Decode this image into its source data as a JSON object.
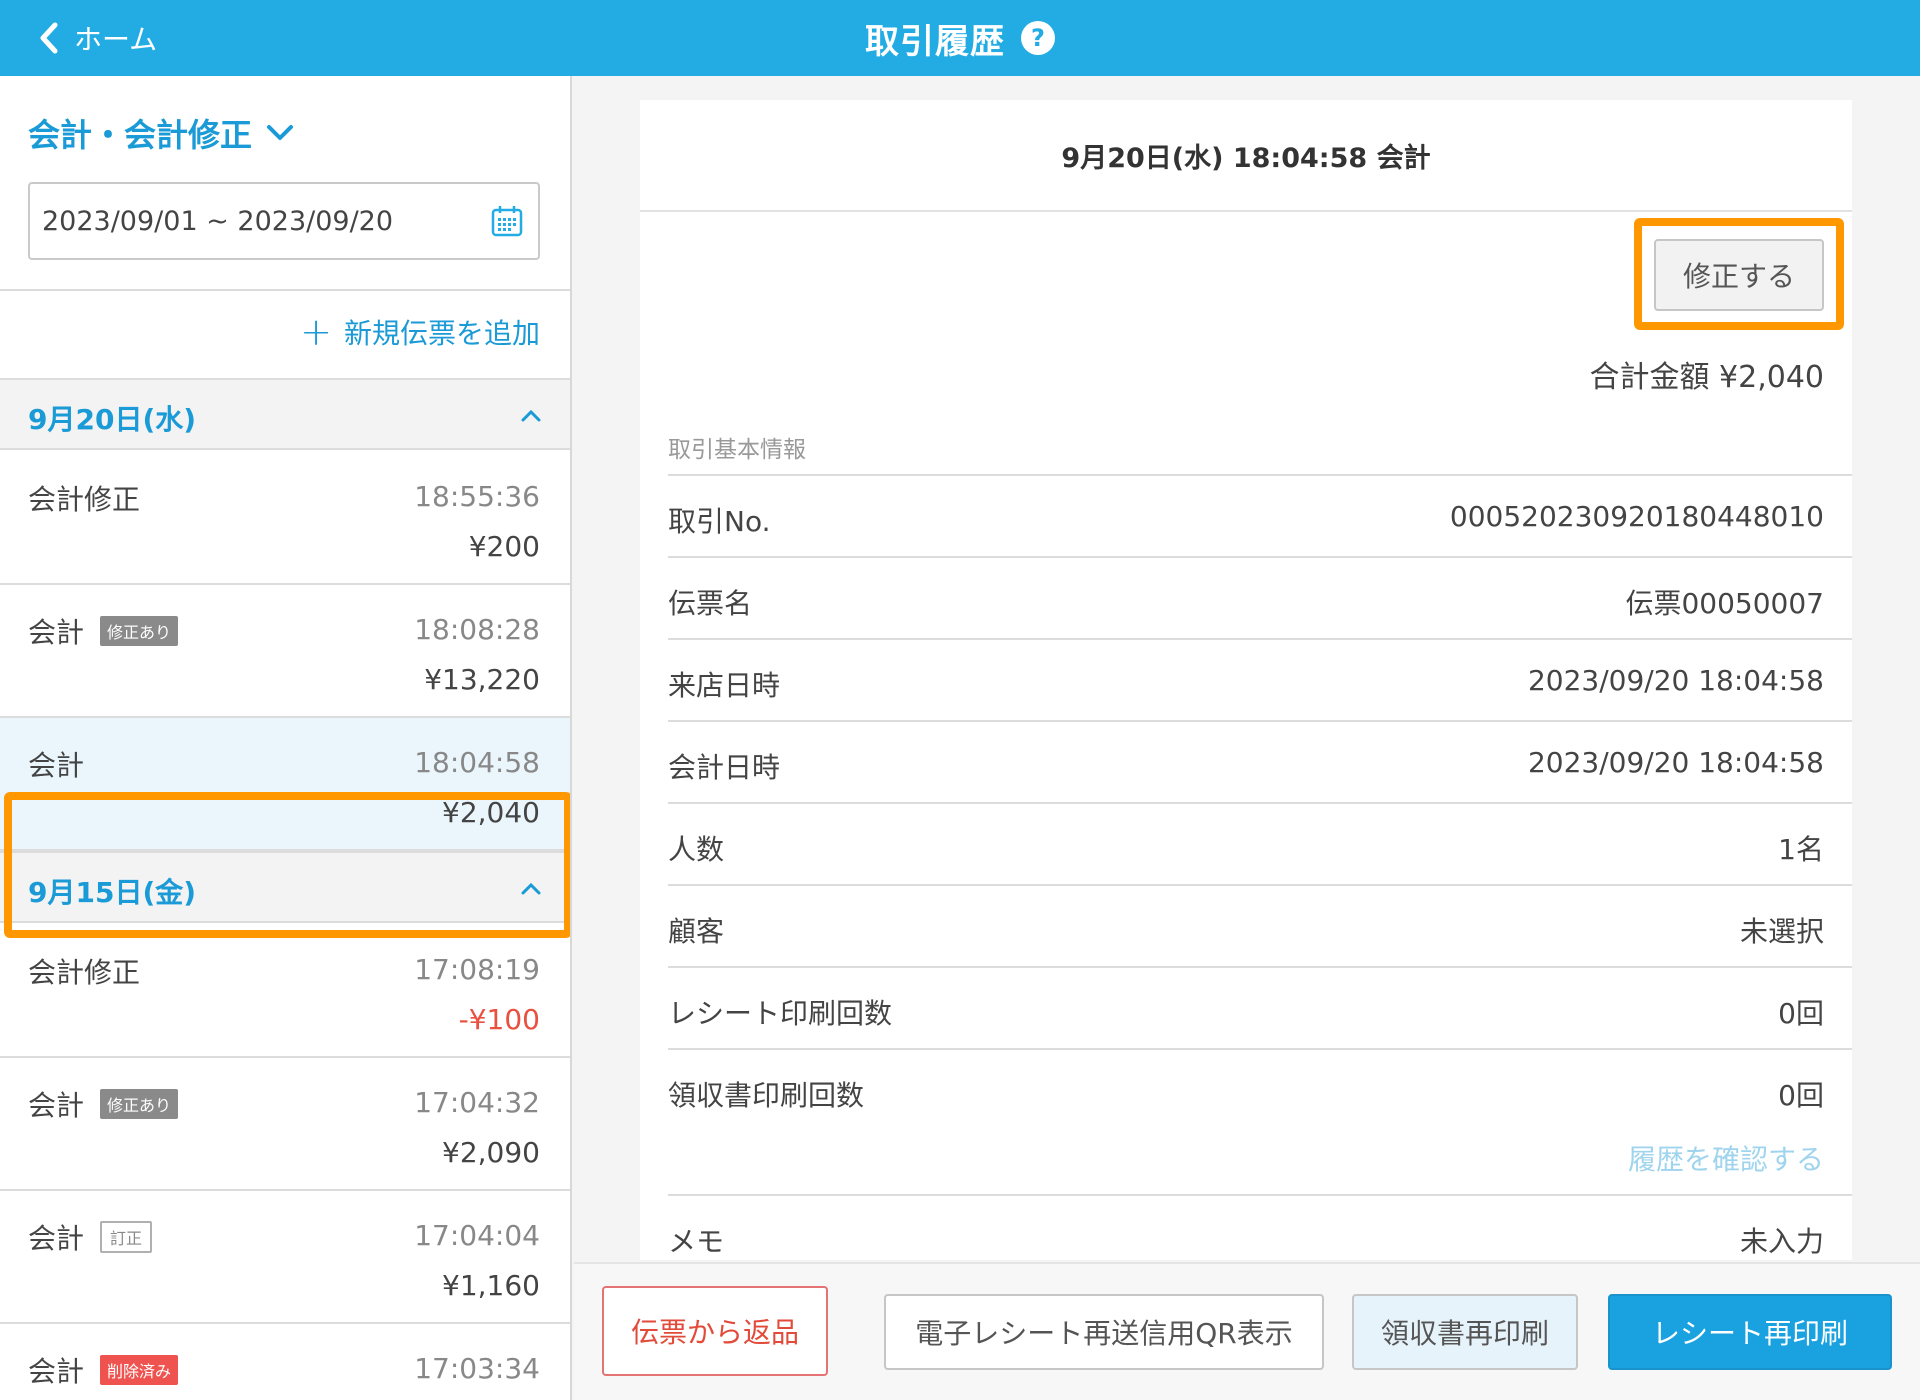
{
  "header": {
    "back_label": "ホーム",
    "title": "取引履歴",
    "help_symbol": "?"
  },
  "sidebar": {
    "filter_label": "会計・会計修正",
    "date_range": "2023/09/01 ~ 2023/09/20",
    "add_slip_label": "新規伝票を追加",
    "groups": [
      {
        "date": "9月20日(水)",
        "items": [
          {
            "kind": "会計修正",
            "time": "18:55:36",
            "amount": "¥200"
          },
          {
            "kind": "会計",
            "badge": "修正あり",
            "time": "18:08:28",
            "amount": "¥13,220"
          },
          {
            "kind": "会計",
            "time": "18:04:58",
            "amount": "¥2,040"
          }
        ]
      },
      {
        "date": "9月15日(金)",
        "items": [
          {
            "kind": "会計修正",
            "time": "17:08:19",
            "amount": "-¥100"
          },
          {
            "kind": "会計",
            "badge": "修正あり",
            "time": "17:04:32",
            "amount": "¥2,090"
          },
          {
            "kind": "会計",
            "badge": "訂正",
            "time": "17:04:04",
            "amount": "¥1,160"
          },
          {
            "kind": "会計",
            "badge": "削除済み",
            "time": "17:03:34",
            "amount": ""
          }
        ]
      }
    ]
  },
  "detail": {
    "title": "9月20日(水) 18:04:58 会計",
    "edit_label": "修正する",
    "total": "合計金額 ¥2,040",
    "section_label": "取引基本情報",
    "rows": [
      {
        "key": "取引No.",
        "value": "00052023092018044801​0"
      },
      {
        "key": "伝票名",
        "value": "伝票00050007"
      },
      {
        "key": "来店日時",
        "value": "2023/09/20 18:04:58"
      },
      {
        "key": "会計日時",
        "value": "2023/09/20 18:04:58"
      },
      {
        "key": "人数",
        "value": "1名"
      },
      {
        "key": "顧客",
        "value": "未選択"
      },
      {
        "key": "レシート印刷回数",
        "value": "0回"
      },
      {
        "key": "領収書印刷回数",
        "value": "0回",
        "link": "履歴を確認する"
      },
      {
        "key": "メモ",
        "value": "未入力"
      }
    ]
  },
  "actions": {
    "return_label": "伝票から返品",
    "qr_label": "電子レシート再送信用QR表示",
    "receipt_label": "領収書再印刷",
    "reprint_label": "レシート再印刷"
  },
  "colors": {
    "header": "#22ace3",
    "accent": "#1a9ad6",
    "highlight": "#ff9800",
    "negative": "#e9503f"
  }
}
